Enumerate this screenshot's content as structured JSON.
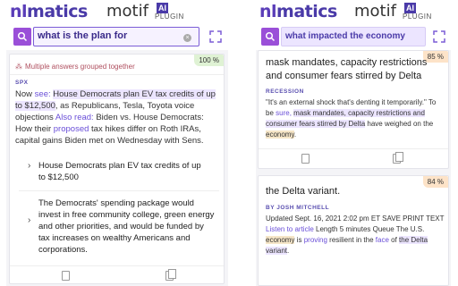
{
  "left": {
    "brand": {
      "nl": "nl",
      "matics": "matics",
      "motif": "motif",
      "ai": "AI",
      "plugin": "PLUGIN"
    },
    "search": {
      "value": "what is the plan for"
    },
    "card": {
      "grouped_text": "Multiple answers grouped together",
      "badge": "100 %",
      "source": "SPX",
      "para_parts": {
        "p1": "Now ",
        "see": "see:",
        "hl": "House Democrats plan EV tax credits of up to $12,500",
        "p2": ", as Republicans, Tesla, Toyota voice objections ",
        "also": "Also read:",
        "p3": " Biden vs. House Democrats: How their ",
        "proposed": "proposed",
        "p4": " tax hikes differ on Roth IRAs, capital gains Biden met on Wednesday with Sens."
      },
      "answers": [
        "House Democrats plan EV tax credits of up to $12,500",
        "The Democrats' spending package would invest in free community college, green energy and other priorities, and would be funded by tax increases on wealthy Americans and corporations."
      ]
    }
  },
  "right": {
    "brand": {
      "nl": "nl",
      "matics": "matics",
      "motif": "motif",
      "ai": "AI",
      "plugin": "PLUGIN"
    },
    "search": {
      "value": "what impacted the economy"
    },
    "card1": {
      "badge": "85 %",
      "title": "mask mandates, capacity restrictions and consumer fears stirred by Delta",
      "source": "RECESSION",
      "para": {
        "p1": "\"It's an external shock that's denting it temporarily.\" To be ",
        "sure": "sure,",
        "hl": "mask mandates, capacity restrictions and consumer fears stirred by Delta",
        "p2": " have weighed on the ",
        "econ": "economy",
        "p3": "."
      }
    },
    "card2": {
      "badge": "84 %",
      "title": "the Delta variant.",
      "source": "BY JOSH MITCHELL",
      "para": {
        "p1": "Updated Sept. 16, 2021 2:02 pm ET SAVE PRINT TEXT ",
        "listen": "Listen to article",
        "p2": " Length 5 minutes Queue The U.S. ",
        "econ": "economy",
        "p3": " is ",
        "proving": "proving",
        "p4": " resilient in the ",
        "face": "face",
        "p5": " of ",
        "hl": "the Delta variant",
        "p6": "."
      }
    }
  }
}
